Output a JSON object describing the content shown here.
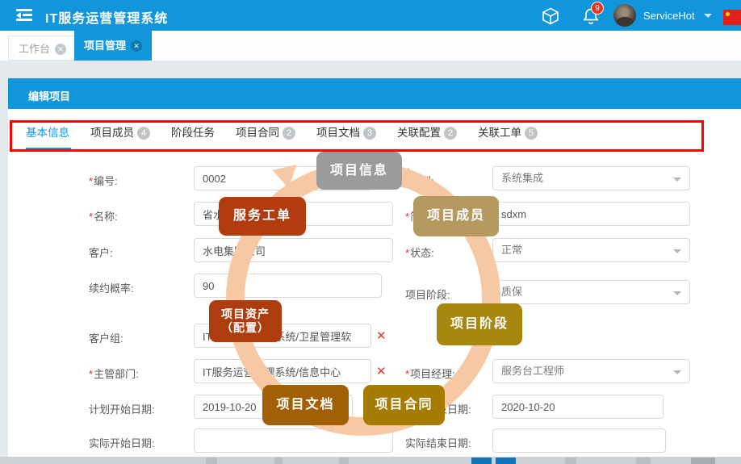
{
  "topbar": {
    "title": "IT服务运营管理系统",
    "user_name": "ServiceHot",
    "notification_count": "9"
  },
  "window_tabs": {
    "workbench": "工作台",
    "project": "项目管理"
  },
  "icons": {
    "tab_close": "✕",
    "clear": "✕"
  },
  "panel": {
    "title": "编辑项目"
  },
  "form_tabs": {
    "t1": {
      "label": "基本信息"
    },
    "t2": {
      "label": "项目成员",
      "badge": "4"
    },
    "t3": {
      "label": "阶段任务"
    },
    "t4": {
      "label": "项目合同",
      "badge": "2"
    },
    "t5": {
      "label": "项目文档",
      "badge": "3"
    },
    "t6": {
      "label": "关联配置",
      "badge": "2"
    },
    "t7": {
      "label": "关联工单",
      "badge": "5"
    }
  },
  "form": {
    "number": {
      "req": "*",
      "label": "编号:",
      "value": "0002"
    },
    "name": {
      "req": "*",
      "label": "名称:",
      "value": "省水"
    },
    "customer": {
      "req": "",
      "label": "客户:",
      "value": "水电集团公司"
    },
    "renewal": {
      "req": "",
      "label": "续约概率:",
      "value": "90"
    },
    "customer_group": {
      "req": "",
      "label": "客户组:",
      "value": "IT服务运营管理系统/卫星管理软"
    },
    "department": {
      "req": "*",
      "label": "主管部门:",
      "value": "IT服务运营管理系统/信息中心"
    },
    "plan_start": {
      "req": "",
      "label": "计划开始日期:",
      "value": "2019-10-20"
    },
    "actual_start": {
      "req": "",
      "label": "实际开始日期:",
      "value": ""
    },
    "type": {
      "req": "*",
      "label": "类型:",
      "value": "系统集成"
    },
    "short_name": {
      "req": "*",
      "label": "简称:",
      "value": "sdxm"
    },
    "status": {
      "req": "*",
      "label": "状态:",
      "value": "正常"
    },
    "stage": {
      "req": "",
      "label": "项目阶段:",
      "value": "质保"
    },
    "manager": {
      "req": "*",
      "label": "项目经理:",
      "value": "服务台工程师"
    },
    "plan_end": {
      "req": "",
      "label": "计划结束日期:",
      "value": "2020-10-20"
    },
    "actual_end": {
      "req": "",
      "label": "实际结束日期:",
      "value": ""
    }
  },
  "overlay": {
    "project_info": "项目信息",
    "service_ticket": "服务工单",
    "project_members": "项目成员",
    "project_assets": "项目资产\n（配置）",
    "project_stage": "项目阶段",
    "project_docs": "项目文档",
    "project_contract": "项目合同",
    "colors": {
      "info": "#9b9b9b",
      "ticket": "#b23c10",
      "members": "#b49a5e",
      "assets": "#ad3c0e",
      "stage": "#a8870e",
      "docs": "#a35f05",
      "contract": "#a67c00",
      "ring": "#f6c9a4",
      "accent_blue": "#1296db",
      "highlight_red": "#fe0000"
    }
  }
}
